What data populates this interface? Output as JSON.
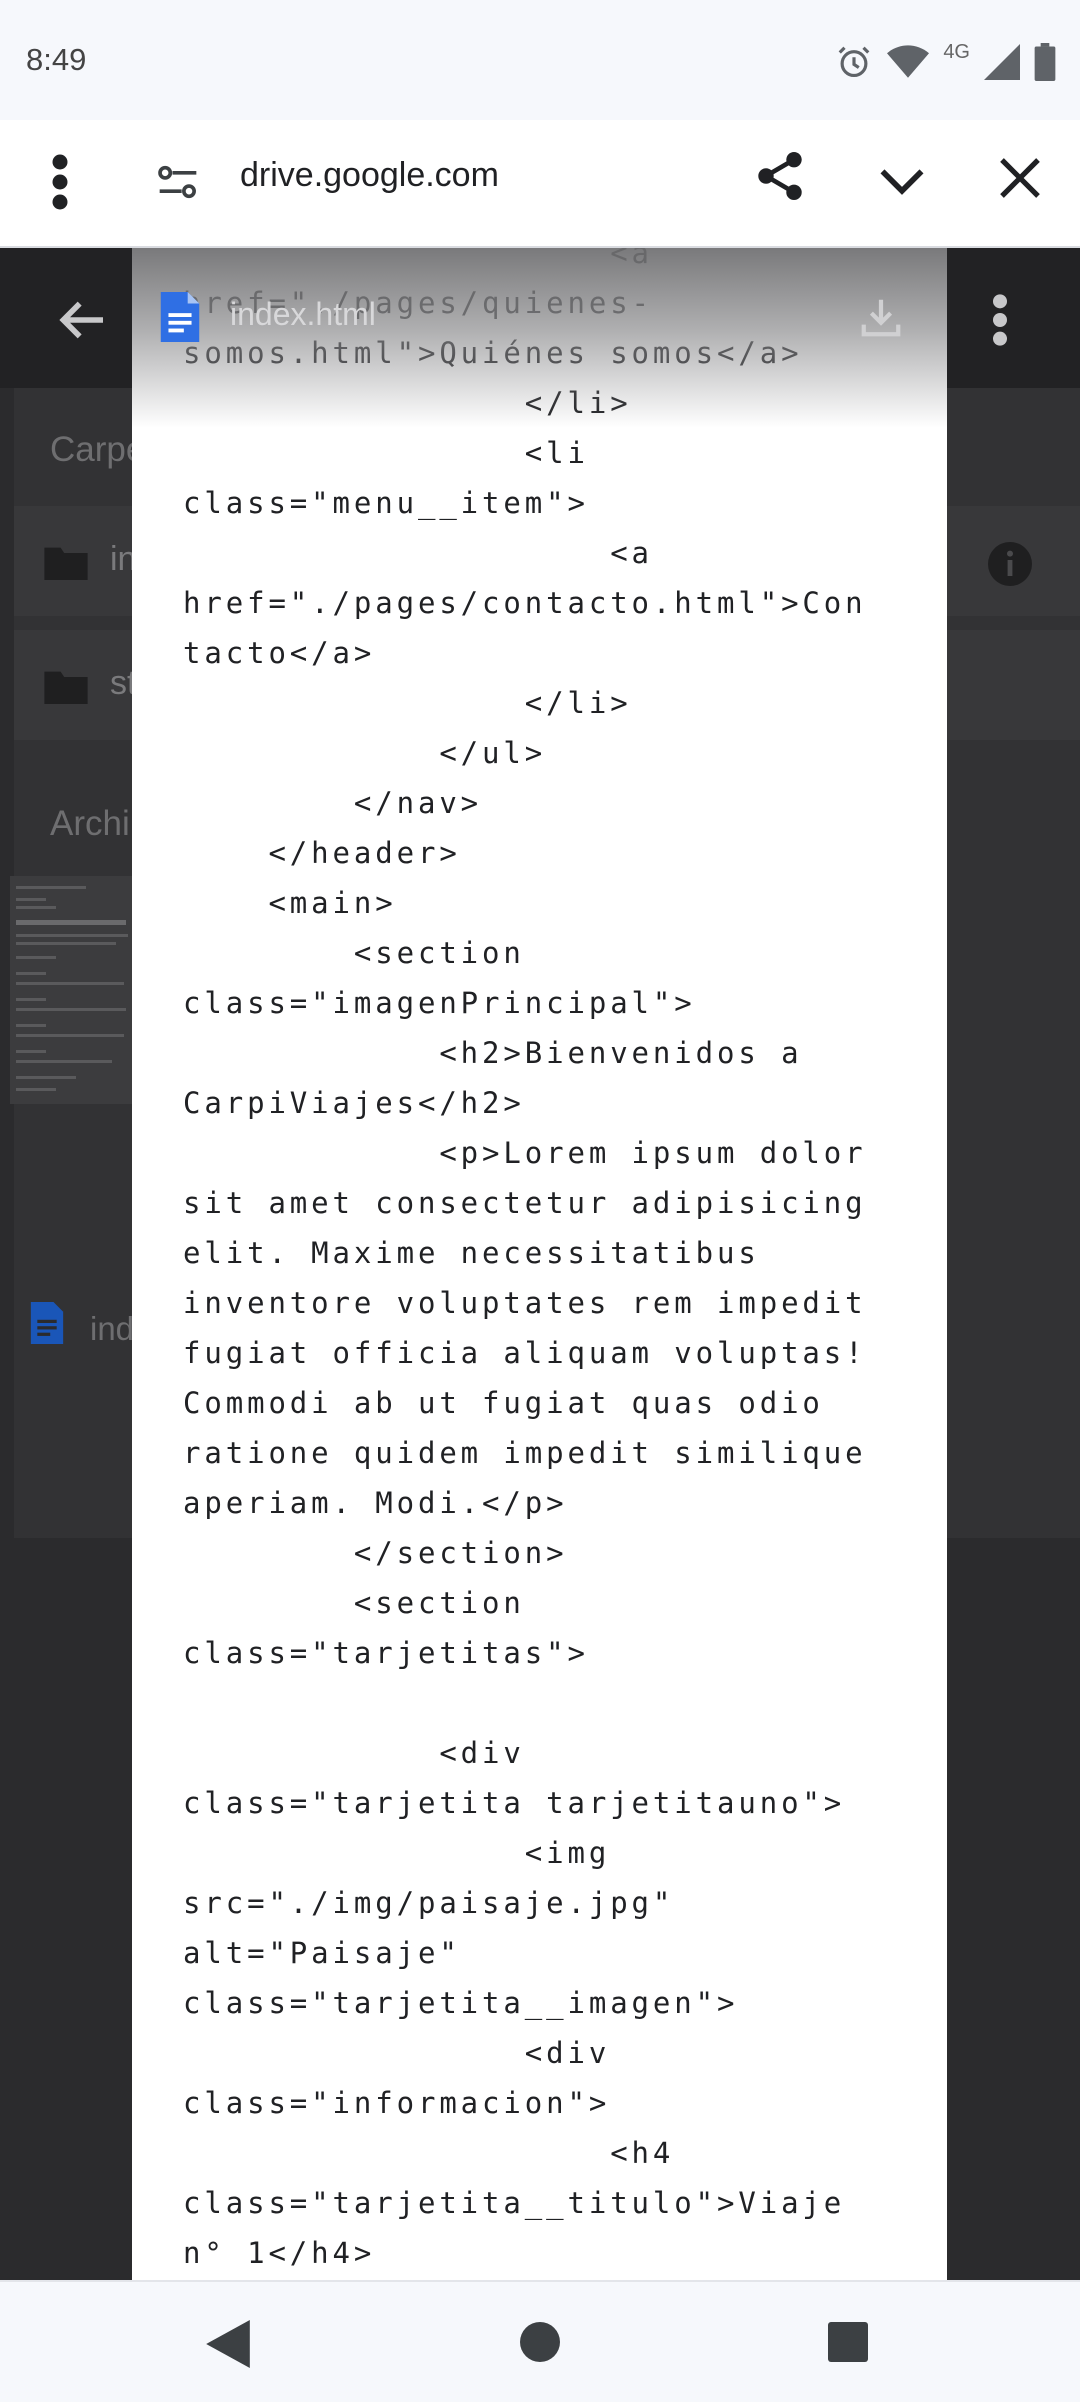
{
  "status_bar": {
    "time": "8:49",
    "network": "4G",
    "icons": [
      "alarm-icon",
      "wifi-icon",
      "signal-icon",
      "battery-icon"
    ]
  },
  "custom_tab": {
    "url": "drive.google.com",
    "icons": [
      "more-vert-icon",
      "site-settings-icon",
      "share-icon",
      "chevron-down-icon",
      "close-icon"
    ]
  },
  "drive": {
    "section_folders": "Carpe",
    "folder_1": "in",
    "folder_2": "st",
    "section_files": "Archi",
    "file_1": "ind"
  },
  "viewer": {
    "file_name": "index.html",
    "code_lines": [
      "                    <a",
      "href=\"./pages/quienes-",
      "somos.html\">Quiénes somos</a>",
      "                </li>",
      "                <li",
      "class=\"menu__item\">",
      "                    <a",
      "href=\"./pages/contacto.html\">Con",
      "tacto</a>",
      "                </li>",
      "            </ul>",
      "        </nav>",
      "    </header>",
      "    <main>",
      "        <section",
      "class=\"imagenPrincipal\">",
      "            <h2>Bienvenidos a",
      "CarpiViajes</h2>",
      "            <p>Lorem ipsum dolor",
      "sit amet consectetur adipisicing",
      "elit. Maxime necessitatibus",
      "inventore voluptates rem impedit",
      "fugiat officia aliquam voluptas!",
      "Commodi ab ut fugiat quas odio",
      "ratione quidem impedit similique",
      "aperiam. Modi.</p>",
      "        </section>",
      "        <section",
      "class=\"tarjetitas\">",
      "",
      "            <div",
      "class=\"tarjetita tarjetitauno\">",
      "                <img",
      "src=\"./img/paisaje.jpg\"",
      "alt=\"Paisaje\"",
      "class=\"tarjetita__imagen\">",
      "                <div",
      "class=\"informacion\">",
      "                    <h4",
      "class=\"tarjetita__titulo\">Viaje",
      "n° 1</h4>"
    ]
  },
  "navigation": {
    "buttons": [
      "back-icon",
      "home-icon",
      "recents-icon"
    ]
  }
}
